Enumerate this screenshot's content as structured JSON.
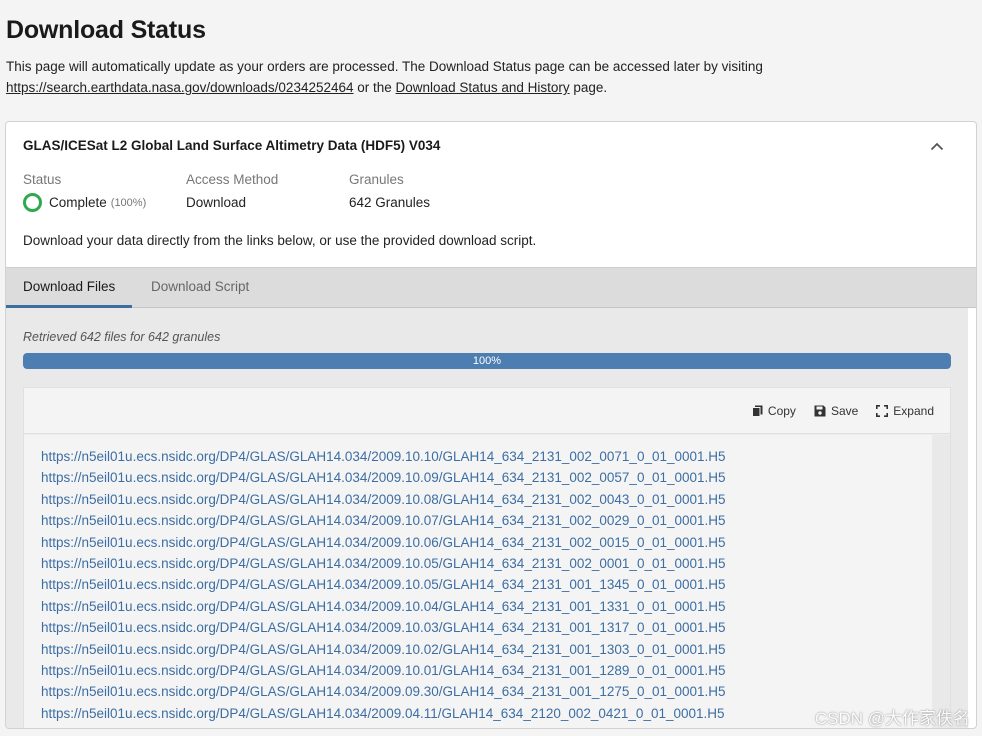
{
  "page": {
    "title": "Download Status",
    "intro_text": "This page will automatically update as your orders are processed. The Download Status page can be accessed later by visiting",
    "intro_link": "https://search.earthdata.nasa.gov/downloads/0234252464",
    "intro_or": " or the ",
    "intro_link2": "Download Status and History",
    "intro_end": " page."
  },
  "order": {
    "title": "GLAS/ICESat L2 Global Land Surface Altimetry Data (HDF5) V034",
    "status_label": "Status",
    "status_value": "Complete",
    "status_pct": "(100%)",
    "access_label": "Access Method",
    "access_value": "Download",
    "granules_label": "Granules",
    "granules_value": "642 Granules",
    "description": "Download your data directly from the links below, or use the provided download script."
  },
  "tabs": {
    "files": "Download Files",
    "script": "Download Script"
  },
  "files_panel": {
    "retrieved": "Retrieved 642 files for 642 granules",
    "progress_label": "100%",
    "progress_value": 100,
    "copy_label": "Copy",
    "save_label": "Save",
    "expand_label": "Expand",
    "links": [
      "https://n5eil01u.ecs.nsidc.org/DP4/GLAS/GLAH14.034/2009.10.10/GLAH14_634_2131_002_0071_0_01_0001.H5",
      "https://n5eil01u.ecs.nsidc.org/DP4/GLAS/GLAH14.034/2009.10.09/GLAH14_634_2131_002_0057_0_01_0001.H5",
      "https://n5eil01u.ecs.nsidc.org/DP4/GLAS/GLAH14.034/2009.10.08/GLAH14_634_2131_002_0043_0_01_0001.H5",
      "https://n5eil01u.ecs.nsidc.org/DP4/GLAS/GLAH14.034/2009.10.07/GLAH14_634_2131_002_0029_0_01_0001.H5",
      "https://n5eil01u.ecs.nsidc.org/DP4/GLAS/GLAH14.034/2009.10.06/GLAH14_634_2131_002_0015_0_01_0001.H5",
      "https://n5eil01u.ecs.nsidc.org/DP4/GLAS/GLAH14.034/2009.10.05/GLAH14_634_2131_002_0001_0_01_0001.H5",
      "https://n5eil01u.ecs.nsidc.org/DP4/GLAS/GLAH14.034/2009.10.05/GLAH14_634_2131_001_1345_0_01_0001.H5",
      "https://n5eil01u.ecs.nsidc.org/DP4/GLAS/GLAH14.034/2009.10.04/GLAH14_634_2131_001_1331_0_01_0001.H5",
      "https://n5eil01u.ecs.nsidc.org/DP4/GLAS/GLAH14.034/2009.10.03/GLAH14_634_2131_001_1317_0_01_0001.H5",
      "https://n5eil01u.ecs.nsidc.org/DP4/GLAS/GLAH14.034/2009.10.02/GLAH14_634_2131_001_1303_0_01_0001.H5",
      "https://n5eil01u.ecs.nsidc.org/DP4/GLAS/GLAH14.034/2009.10.01/GLAH14_634_2131_001_1289_0_01_0001.H5",
      "https://n5eil01u.ecs.nsidc.org/DP4/GLAS/GLAH14.034/2009.09.30/GLAH14_634_2131_001_1275_0_01_0001.H5",
      "https://n5eil01u.ecs.nsidc.org/DP4/GLAS/GLAH14.034/2009.04.11/GLAH14_634_2120_002_0421_0_01_0001.H5"
    ]
  },
  "watermark": "CSDN @大作家佚名",
  "colors": {
    "accent": "#3c6e9e",
    "link": "#3c6ea3",
    "progress": "#4d7eb2",
    "complete": "#2fa84f"
  }
}
